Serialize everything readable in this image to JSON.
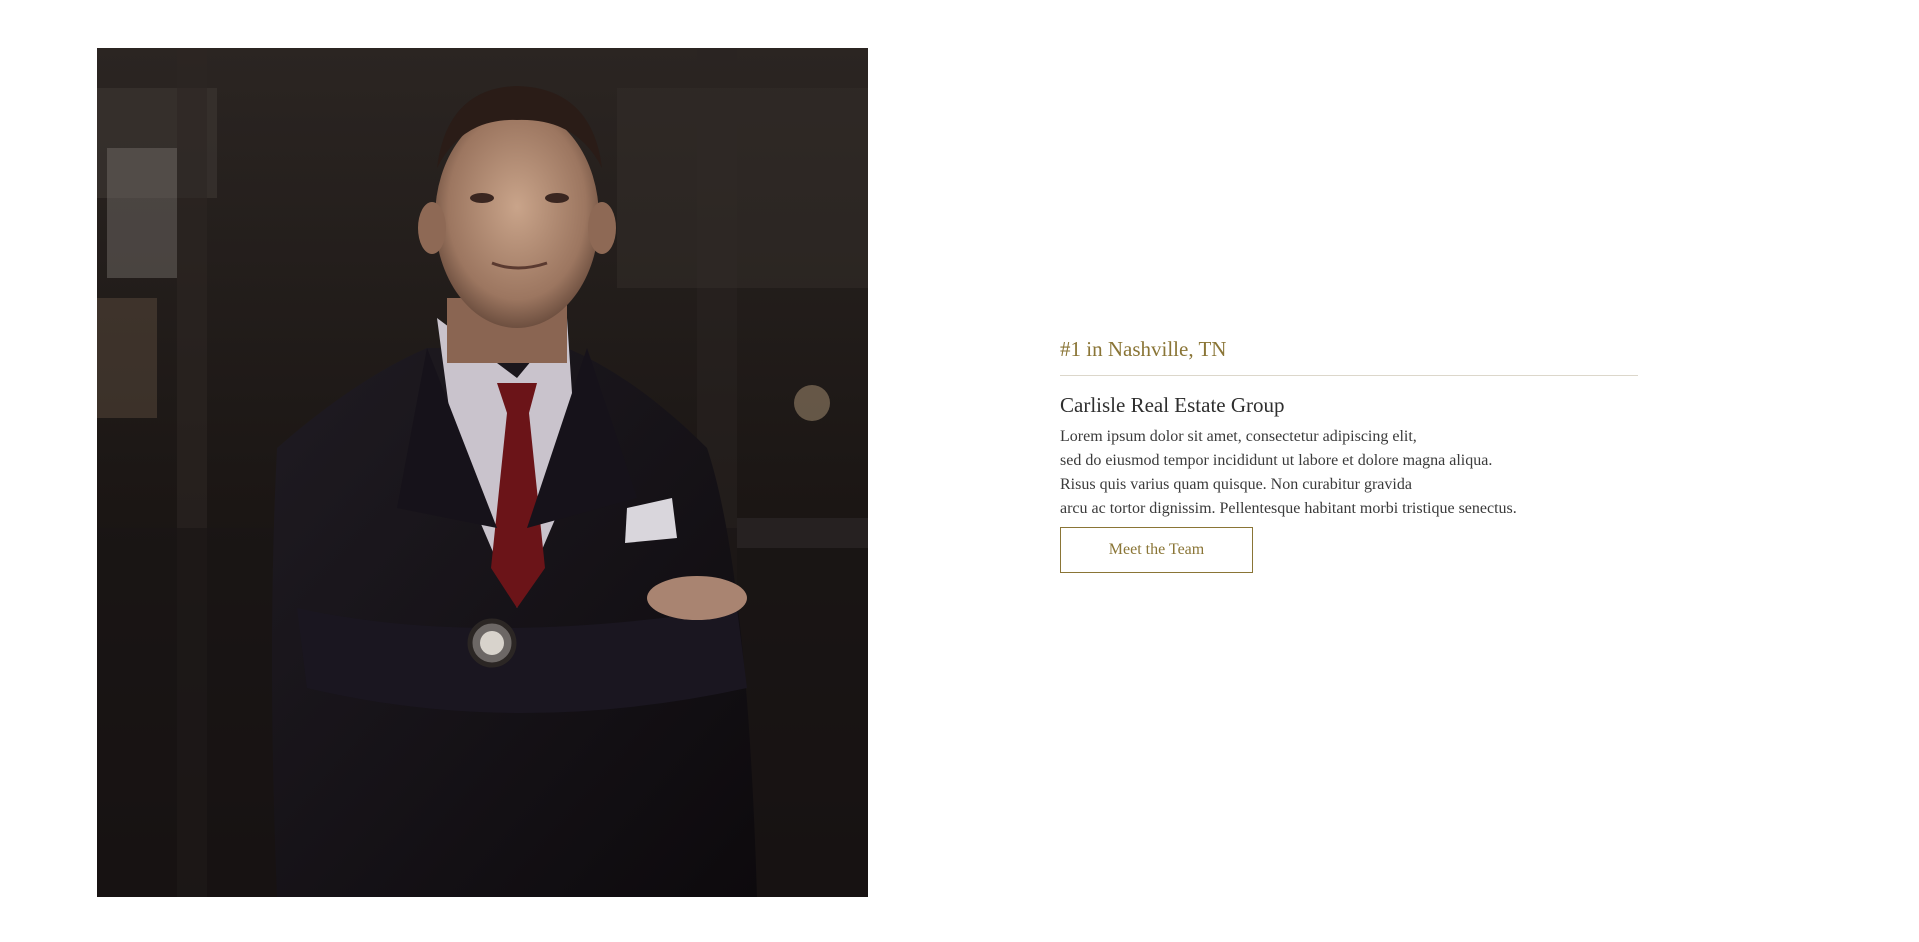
{
  "hero": {
    "photo_alt": "man-in-suit-portrait"
  },
  "intro": {
    "tagline": "#1 in Nashville, TN",
    "company": "Carlisle Real Estate Group",
    "description_lines": [
      "Lorem ipsum dolor sit amet, consectetur adipiscing elit,",
      "sed do eiusmod tempor incididunt ut labore et dolore magna aliqua.",
      "Risus quis varius quam quisque. Non curabitur gravida",
      "arcu ac tortor dignissim. Pellentesque habitant morbi tristique senectus."
    ],
    "cta_label": "Meet the Team"
  },
  "colors": {
    "accent": "#8a7536",
    "text": "#2e2e2e",
    "divider": "#dcd7cb",
    "background": "#ffffff"
  }
}
